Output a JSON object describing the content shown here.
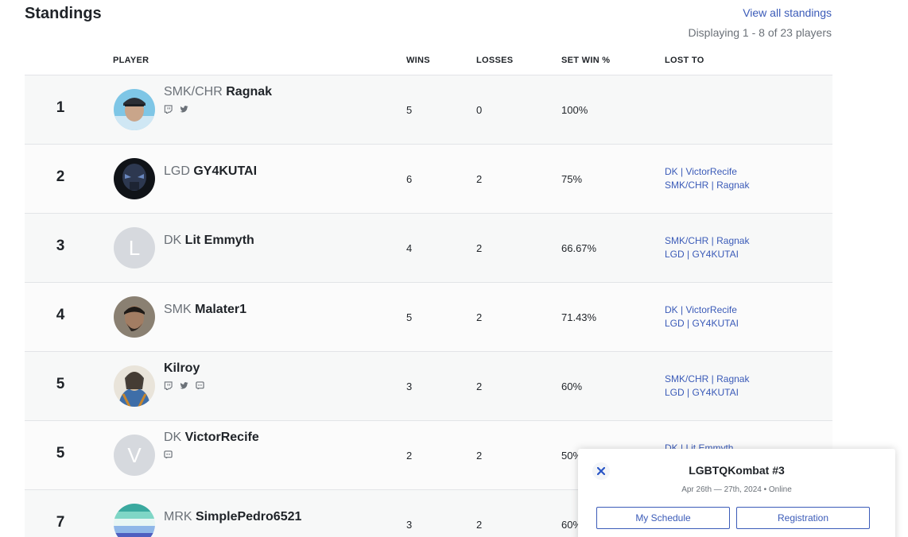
{
  "header": {
    "title": "Standings",
    "view_all": "View all standings",
    "displaying": "Displaying 1 - 8 of 23 players"
  },
  "columns": {
    "player": "PLAYER",
    "wins": "WINS",
    "losses": "LOSSES",
    "set_win": "SET WIN %",
    "lost_to": "LOST TO"
  },
  "rows": [
    {
      "rank": "1",
      "prefix": "SMK/CHR",
      "tag": "Ragnak",
      "wins": "5",
      "losses": "0",
      "pct": "100%",
      "lost_to": [],
      "socials": [
        "twitch-icon",
        "twitter-icon"
      ],
      "avatar": "photo",
      "avatar_color": "#4aa3c8"
    },
    {
      "rank": "2",
      "prefix": "LGD",
      "tag": "GY4KUTAI",
      "wins": "6",
      "losses": "2",
      "pct": "75%",
      "lost_to": [
        "DK | VictorRecife",
        "SMK/CHR | Ragnak"
      ],
      "socials": [],
      "avatar": "photo",
      "avatar_color": "#1b1f2a"
    },
    {
      "rank": "3",
      "prefix": "DK",
      "tag": "Lit Emmyth",
      "wins": "4",
      "losses": "2",
      "pct": "66.67%",
      "lost_to": [
        "SMK/CHR | Ragnak",
        "LGD | GY4KUTAI"
      ],
      "socials": [],
      "avatar": "L",
      "avatar_color": "#d6d9de"
    },
    {
      "rank": "4",
      "prefix": "SMK",
      "tag": "Malater1",
      "wins": "5",
      "losses": "2",
      "pct": "71.43%",
      "lost_to": [
        "DK | VictorRecife",
        "LGD | GY4KUTAI"
      ],
      "socials": [],
      "avatar": "photo",
      "avatar_color": "#5a5048"
    },
    {
      "rank": "5",
      "prefix": "",
      "tag": "Kilroy",
      "wins": "3",
      "losses": "2",
      "pct": "60%",
      "lost_to": [
        "SMK/CHR | Ragnak",
        "LGD | GY4KUTAI"
      ],
      "socials": [
        "twitch-icon",
        "twitter-icon",
        "discord-icon"
      ],
      "avatar": "photo",
      "avatar_color": "#c9b39a"
    },
    {
      "rank": "5",
      "prefix": "DK",
      "tag": "VictorRecife",
      "wins": "2",
      "losses": "2",
      "pct": "50%",
      "lost_to": [
        "DK | Lit Emmyth"
      ],
      "socials": [
        "discord-icon"
      ],
      "avatar": "V",
      "avatar_color": "#d6d9de"
    },
    {
      "rank": "7",
      "prefix": "MRK",
      "tag": "SimplePedro6521",
      "wins": "3",
      "losses": "2",
      "pct": "60%",
      "lost_to": [],
      "socials": [],
      "avatar": "photo",
      "avatar_color": "#6fd0c8"
    }
  ],
  "event_card": {
    "title": "LGBTQKombat #3",
    "subtitle": "Apr 26th — 27th, 2024 • Online",
    "schedule_label": "My Schedule",
    "registration_label": "Registration"
  },
  "colors": {
    "accent": "#3b5bb8",
    "muted": "#6b7178"
  }
}
